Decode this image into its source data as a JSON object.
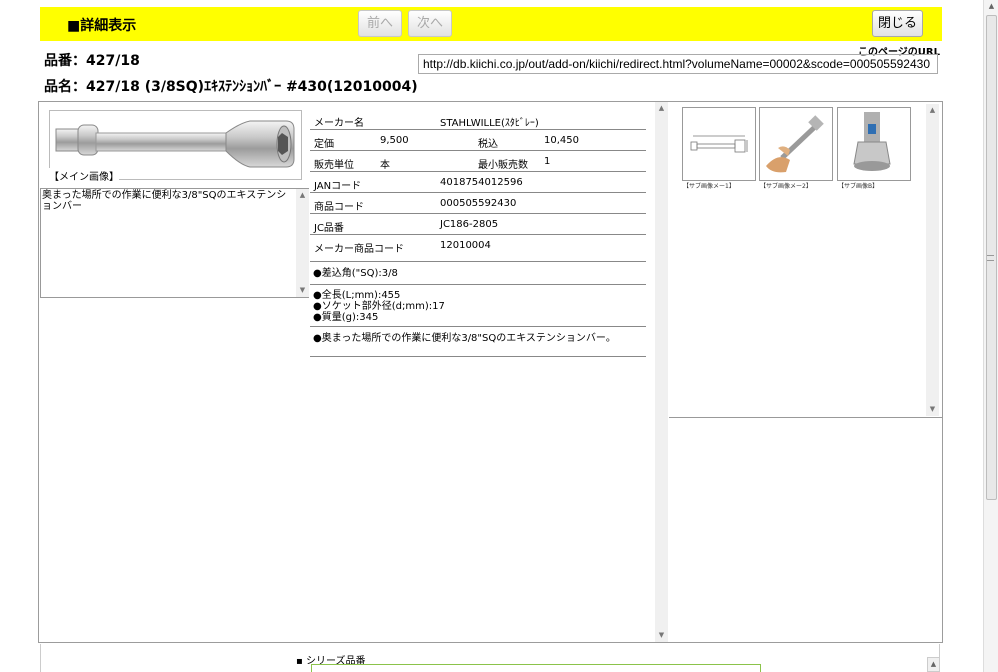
{
  "header": {
    "title": "■詳細表示",
    "prev_label": "前へ",
    "next_label": "次へ",
    "close_label": "閉じる"
  },
  "product": {
    "code_line": "品番：427/18",
    "name_line": "品名：427/18 (3/8SQ)ｴｷｽﾃﾝｼｮﾝﾊﾞｰ #430(12010004)"
  },
  "page_url": {
    "label": "このページのURL",
    "value": "http://db.kiichi.co.jp/out/add-on/kiichi/redirect.html?volumeName=00002&scode=000505592430"
  },
  "main_image": {
    "caption": "【メイン画像】"
  },
  "description": "奥まった場所での作業に便利な3/8\"SQのエキステンションバー",
  "spec": {
    "maker_label": "メーカー名",
    "maker_value": "STAHLWILLE(ｽﾀﾋﾞﾚｰ)",
    "list_price_label": "定価",
    "list_price_value": "9,500",
    "tax_in_label": "税込",
    "tax_in_value": "10,450",
    "unit_label": "販売単位",
    "unit_value": "本",
    "min_qty_label": "最小販売数",
    "min_qty_value": "1",
    "jan_label": "JANコード",
    "jan_value": "4018754012596",
    "product_code_label": "商品コード",
    "product_code_value": "000505592430",
    "jc_label": "JC品番",
    "jc_value": "JC186-2805",
    "maker_code_label": "メーカー商品コード",
    "maker_code_value": "12010004",
    "bullet_drive": "●差込角(\"SQ):3/8",
    "bullet_length": "●全長(L;mm):455",
    "bullet_socket": "●ソケット部外径(d;mm):17",
    "bullet_weight": "●質量(g):345",
    "bullet_desc": "●奥まった場所での作業に便利な3/8\"SQのエキステンションバー。"
  },
  "sub_images": [
    {
      "caption": "【サブ画像メー1】"
    },
    {
      "caption": "【サブ画像メー2】"
    },
    {
      "caption": "【サブ画像B】"
    }
  ],
  "series": {
    "label": "シリーズ品番"
  }
}
